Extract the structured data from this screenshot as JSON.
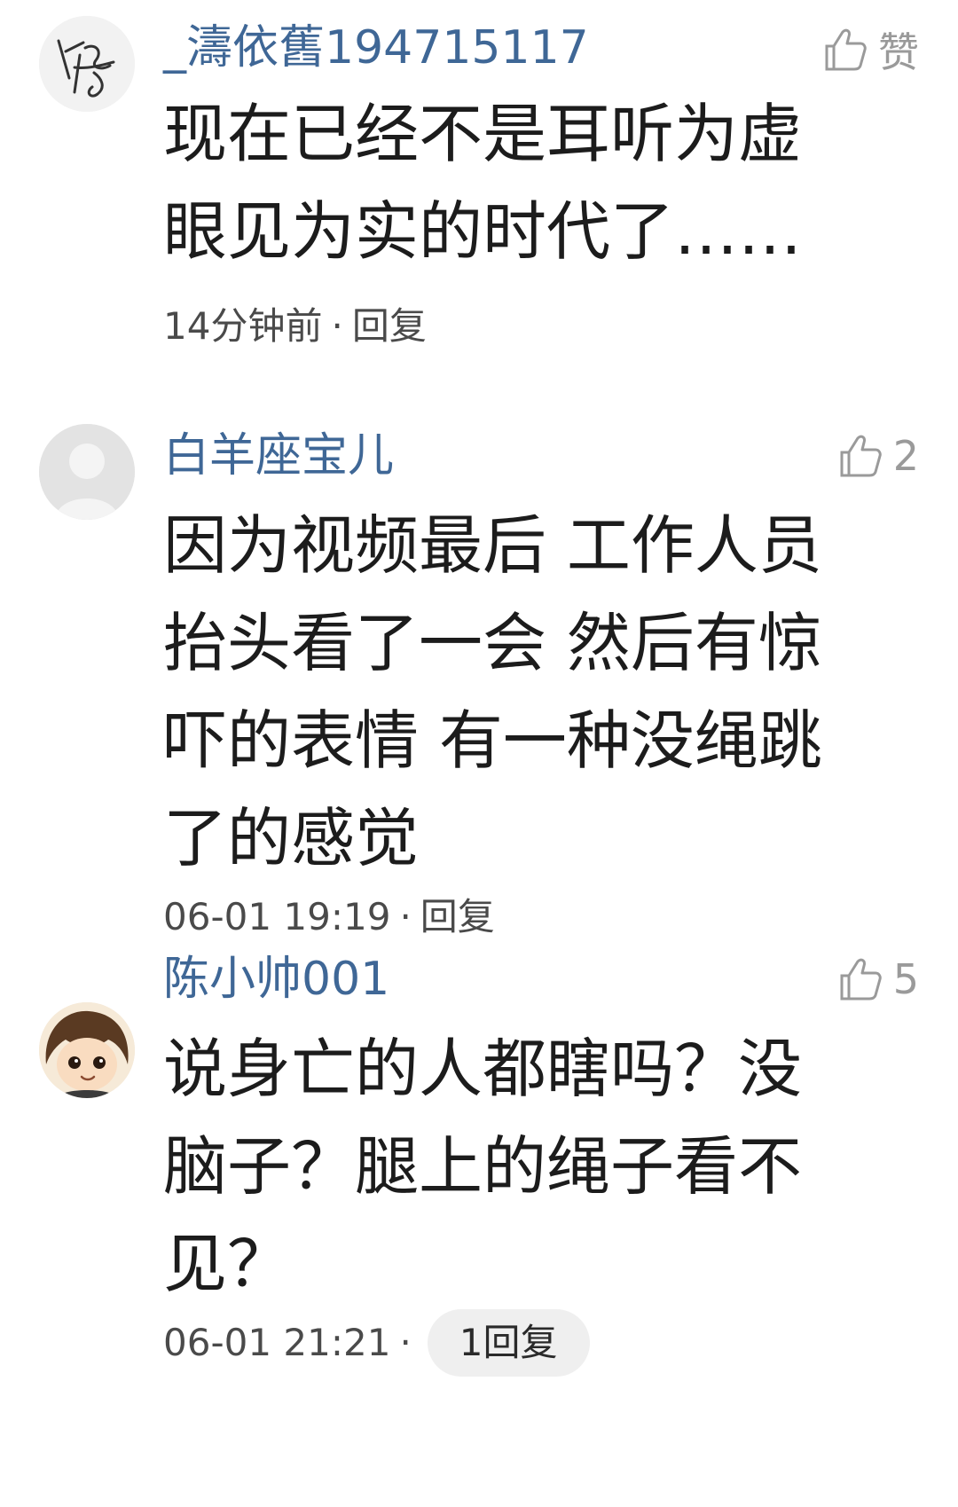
{
  "comments": [
    {
      "username": "_濤依舊194715117",
      "like_label": "赞",
      "text": "现在已经不是耳听为虚\n眼见为实的时代了……",
      "time": "14分钟前",
      "separator": "·",
      "reply_label": "回复"
    },
    {
      "username": "白羊座宝儿",
      "like_label": "2",
      "text": "因为视频最后 工作人员\n抬头看了一会 然后有惊\n吓的表情 有一种没绳跳\n了的感觉",
      "time": "06-01 19:19",
      "separator": "·",
      "reply_label": "回复"
    },
    {
      "username": "陈小帅001",
      "like_label": "5",
      "text": "说身亡的人都瞎吗？没\n脑子？腿上的绳子看不\n见？",
      "time": "06-01 21:21",
      "separator": "·",
      "reply_label": "1回复"
    }
  ],
  "colors": {
    "username": "#3f6796",
    "text": "#1c1c1c",
    "meta": "#4a4a4a",
    "like": "#9a9a9a",
    "reply_pill_bg": "#efefef"
  },
  "icons": {
    "like": "thumbs-up-icon",
    "avatar_placeholder": "default-user-avatar-icon"
  }
}
